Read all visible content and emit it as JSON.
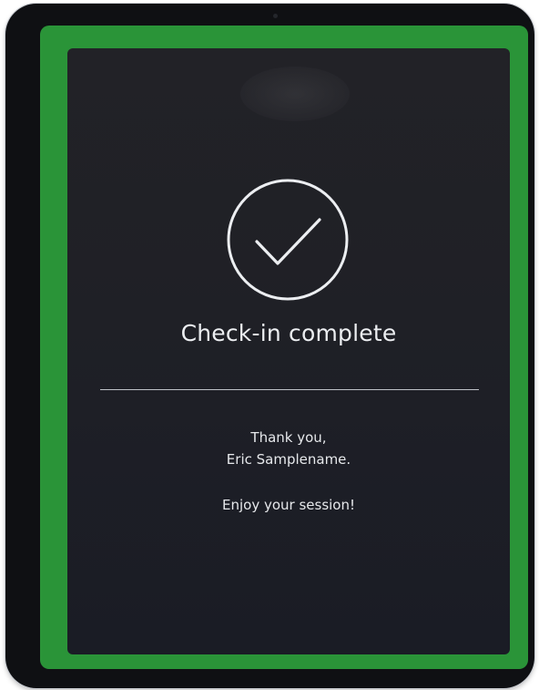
{
  "screen": {
    "status_icon": "checkmark-circle-icon",
    "title": "Check-in complete",
    "thanks_line": "Thank you,",
    "name_line": "Eric Samplename.",
    "closing_line": "Enjoy your session!"
  },
  "colors": {
    "frame_green": "#2a9438",
    "bezel": "#0f1013",
    "screen_bg": "#1f2026",
    "text": "#eceef1"
  }
}
